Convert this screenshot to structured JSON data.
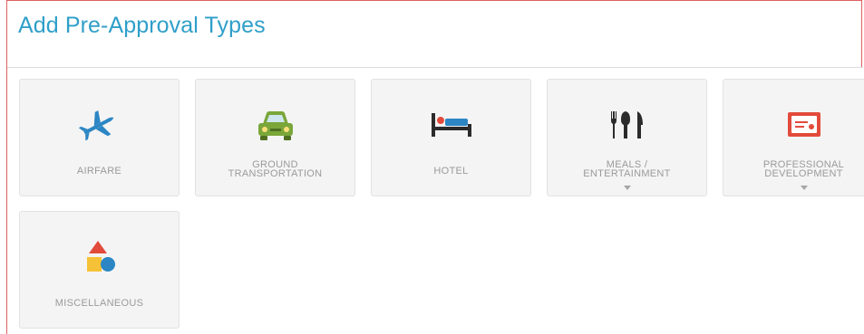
{
  "page": {
    "title": "Add Pre-Approval Types"
  },
  "types": [
    {
      "label": "AIRFARE",
      "icon": "airplane-icon",
      "has_dropdown": false
    },
    {
      "label": "GROUND\nTRANSPORTATION",
      "icon": "car-icon",
      "has_dropdown": false
    },
    {
      "label": "HOTEL",
      "icon": "bed-icon",
      "has_dropdown": false
    },
    {
      "label": "MEALS /\nENTERTAINMENT",
      "icon": "utensils-icon",
      "has_dropdown": true
    },
    {
      "label": "PROFESSIONAL\nDEVELOPMENT",
      "icon": "certificate-icon",
      "has_dropdown": true
    },
    {
      "label": "MISCELLANEOUS",
      "icon": "shapes-icon",
      "has_dropdown": false
    }
  ],
  "colors": {
    "title": "#2f9fc9",
    "airplane": "#2c86c4",
    "car": "#7aa63a",
    "bed": "#2c86c4",
    "utensils": "#2b2b2b",
    "certificate": "#e24b3b",
    "shape_triangle": "#e24b3b",
    "shape_square": "#f5c237",
    "shape_circle": "#2c86c4"
  }
}
